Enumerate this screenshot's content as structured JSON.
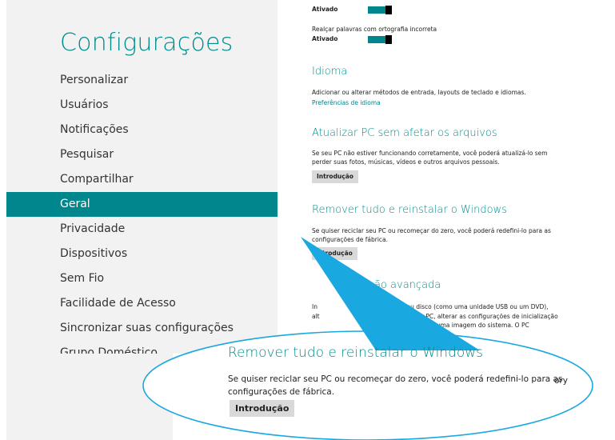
{
  "left_panel": {
    "title": "Configurações",
    "items": [
      {
        "label": "Personalizar",
        "active": false
      },
      {
        "label": "Usuários",
        "active": false
      },
      {
        "label": "Notificações",
        "active": false
      },
      {
        "label": "Pesquisar",
        "active": false
      },
      {
        "label": "Compartilhar",
        "active": false
      },
      {
        "label": "Geral",
        "active": true
      },
      {
        "label": "Privacidade",
        "active": false
      },
      {
        "label": "Dispositivos",
        "active": false
      },
      {
        "label": "Sem Fio",
        "active": false
      },
      {
        "label": "Facilidade de Acesso",
        "active": false
      },
      {
        "label": "Sincronizar suas configurações",
        "active": false
      },
      {
        "label": "Grupo Doméstico",
        "active": false
      }
    ]
  },
  "right_panel": {
    "top_toggle_state": "Ativado",
    "spell_label": "Realçar palavras com ortografia incorreta",
    "spell_state": "Ativado",
    "idioma": {
      "title": "Idioma",
      "desc": "Adicionar ou alterar métodos de entrada, layouts de teclado e idiomas.",
      "link": "Preferências de idioma"
    },
    "refresh": {
      "title": "Atualizar PC sem afetar os arquivos",
      "desc_line1": "Se seu PC não estiver funcionando corretamente, você poderá atualizá-lo sem",
      "desc_line2": "perder suas fotos, músicas, vídeos e outros arquivos pessoais.",
      "button": "Introdução"
    },
    "reset": {
      "title": "Remover tudo e reinstalar o Windows",
      "desc_line1": "Se quiser reciclar seu PC ou recomeçar do zero, você poderá redefini-lo para as",
      "desc_line2": "configurações de fábrica.",
      "button": "Introdução",
      "button_visible": "trodução"
    },
    "advanced": {
      "title_visible": "ão avançada",
      "line1_a": "In",
      "line1_b": "dispositivo ou disco (como uma unidade USB ou um DVD),",
      "line2_a": "alt",
      "line2_b": "firmware do PC, alterar as configurações de inicialização",
      "line3_b": "meio de uma imagem do sistema. O PC"
    }
  },
  "callout": {
    "title": "Remover tudo e reinstalar o Windows",
    "desc_line1": "Se quiser reciclar seu PC ou recomeçar do zero, você poderá redefini-lo para as",
    "desc_line2": "configurações de fábrica.",
    "button": "Introdução",
    "overflow_text": "ory",
    "accent_color": "#1aa8e0"
  },
  "colors": {
    "accent": "#008c8c",
    "active_nav": "#00878e",
    "panel_bg": "#f2f2f2",
    "callout": "#1aa8e0"
  }
}
